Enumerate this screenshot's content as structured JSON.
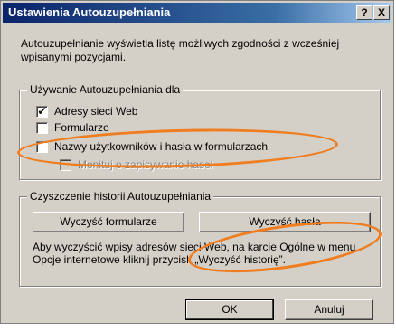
{
  "window": {
    "title": "Ustawienia Autouzupełniania",
    "help_label": "?",
    "close_label": "X"
  },
  "description": "Autouzupełnianie wyświetla listę możliwych zgodności z wcześniej wpisanymi pozycjami.",
  "use_group": {
    "legend": "Używanie Autouzupełniania dla",
    "items": [
      {
        "label": "Adresy sieci Web",
        "checked": true,
        "mark": "✔"
      },
      {
        "label": "Formularze",
        "checked": false,
        "mark": ""
      },
      {
        "label": "Nazwy użytkowników i hasła w formularzach",
        "checked": false,
        "mark": ""
      },
      {
        "label": "Monituj o zapisywanie haseł",
        "checked": false,
        "mark": "",
        "disabled": true
      }
    ]
  },
  "history_group": {
    "legend": "Czyszczenie historii Autouzupełniania",
    "clear_forms_label": "Wyczyść formularze",
    "clear_passwords_label": "Wyczyść hasła",
    "note": "Aby wyczyścić wpisy adresów sieci Web, na karcie Ogólne w menu Opcje internetowe kliknij przycisk „Wyczyść historię”."
  },
  "buttons": {
    "ok_label": "OK",
    "cancel_label": "Anuluj"
  },
  "colors": {
    "annotation": "#f07d20",
    "titlebar_start": "#0a246a",
    "dialog_bg": "#d4d0c8"
  }
}
